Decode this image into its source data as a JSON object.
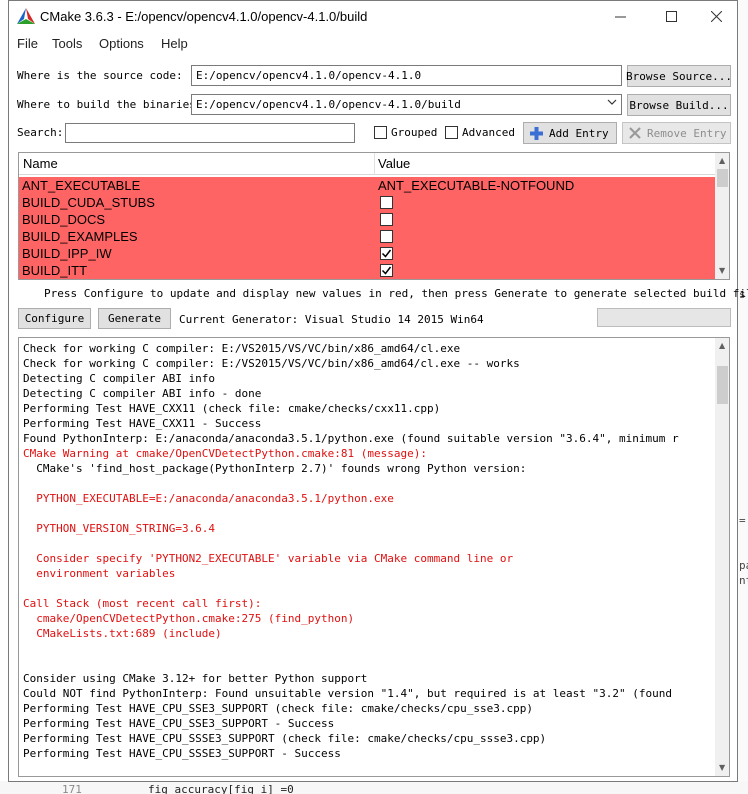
{
  "window": {
    "title": "CMake 3.6.3 - E:/opencv/opencv4.1.0/opencv-4.1.0/build",
    "controls": [
      "minimize",
      "maximize",
      "close"
    ]
  },
  "menu": [
    "File",
    "Tools",
    "Options",
    "Help"
  ],
  "paths": {
    "source_label": "Where is the source code:",
    "source_value": "E:/opencv/opencv4.1.0/opencv-4.1.0",
    "browse_source": "Browse Source...",
    "build_label": "Where to build the binaries:",
    "build_value": "E:/opencv/opencv4.1.0/opencv-4.1.0/build",
    "browse_build": "Browse Build..."
  },
  "search": {
    "label": "Search:",
    "value": "",
    "grouped_label": "Grouped",
    "grouped_checked": false,
    "advanced_label": "Advanced",
    "advanced_checked": false,
    "add_entry": "Add Entry",
    "remove_entry": "Remove Entry"
  },
  "cache_table": {
    "columns": [
      "Name",
      "Value"
    ],
    "row_color": "#ff6464",
    "rows": [
      {
        "name": "ANT_EXECUTABLE",
        "value": "ANT_EXECUTABLE-NOTFOUND",
        "type": "text"
      },
      {
        "name": "BUILD_CUDA_STUBS",
        "checked": false,
        "type": "bool"
      },
      {
        "name": "BUILD_DOCS",
        "checked": false,
        "type": "bool"
      },
      {
        "name": "BUILD_EXAMPLES",
        "checked": false,
        "type": "bool"
      },
      {
        "name": "BUILD_IPP_IW",
        "checked": true,
        "type": "bool"
      },
      {
        "name": "BUILD_ITT",
        "checked": true,
        "type": "bool"
      }
    ]
  },
  "hint": "Press Configure to update and display new values in red, then press Generate to generate selected build files.",
  "actions": {
    "configure": "Configure",
    "generate": "Generate",
    "current_generator": "Current Generator: Visual Studio 14 2015 Win64"
  },
  "log": [
    {
      "text": "Check for working C compiler: E:/VS2015/VS/VC/bin/x86_amd64/cl.exe",
      "color": "black"
    },
    {
      "text": "Check for working C compiler: E:/VS2015/VS/VC/bin/x86_amd64/cl.exe -- works",
      "color": "black"
    },
    {
      "text": "Detecting C compiler ABI info",
      "color": "black"
    },
    {
      "text": "Detecting C compiler ABI info - done",
      "color": "black"
    },
    {
      "text": "Performing Test HAVE_CXX11 (check file: cmake/checks/cxx11.cpp)",
      "color": "black"
    },
    {
      "text": "Performing Test HAVE_CXX11 - Success",
      "color": "black"
    },
    {
      "text": "Found PythonInterp: E:/anaconda/anaconda3.5.1/python.exe (found suitable version \"3.6.4\", minimum r",
      "color": "black"
    },
    {
      "text": "CMake Warning at cmake/OpenCVDetectPython.cmake:81 (message):",
      "color": "red"
    },
    {
      "text": "  CMake's 'find_host_package(PythonInterp 2.7)' founds wrong Python version:",
      "color": "black"
    },
    {
      "text": "",
      "color": "black"
    },
    {
      "text": "  PYTHON_EXECUTABLE=E:/anaconda/anaconda3.5.1/python.exe",
      "color": "red"
    },
    {
      "text": "",
      "color": "black"
    },
    {
      "text": "  PYTHON_VERSION_STRING=3.6.4",
      "color": "red"
    },
    {
      "text": "",
      "color": "black"
    },
    {
      "text": "  Consider specify 'PYTHON2_EXECUTABLE' variable via CMake command line or",
      "color": "red"
    },
    {
      "text": "  environment variables",
      "color": "red"
    },
    {
      "text": "",
      "color": "black"
    },
    {
      "text": "Call Stack (most recent call first):",
      "color": "red"
    },
    {
      "text": "  cmake/OpenCVDetectPython.cmake:275 (find_python)",
      "color": "red"
    },
    {
      "text": "  CMakeLists.txt:689 (include)",
      "color": "red"
    },
    {
      "text": "",
      "color": "black"
    },
    {
      "text": "",
      "color": "black"
    },
    {
      "text": "Consider using CMake 3.12+ for better Python support",
      "color": "black"
    },
    {
      "text": "Could NOT find PythonInterp: Found unsuitable version \"1.4\", but required is at least \"3.2\" (found",
      "color": "black"
    },
    {
      "text": "Performing Test HAVE_CPU_SSE3_SUPPORT (check file: cmake/checks/cpu_sse3.cpp)",
      "color": "black"
    },
    {
      "text": "Performing Test HAVE_CPU_SSE3_SUPPORT - Success",
      "color": "black"
    },
    {
      "text": "Performing Test HAVE_CPU_SSSE3_SUPPORT (check file: cmake/checks/cpu_ssse3.cpp)",
      "color": "black"
    },
    {
      "text": "Performing Test HAVE_CPU_SSSE3_SUPPORT - Success",
      "color": "black"
    }
  ],
  "background_window": {
    "right_fragments": [
      "s",
      "=",
      "pa",
      "nt"
    ],
    "line_number": "171",
    "code": "fig_accuracy[fig_i] =0"
  }
}
